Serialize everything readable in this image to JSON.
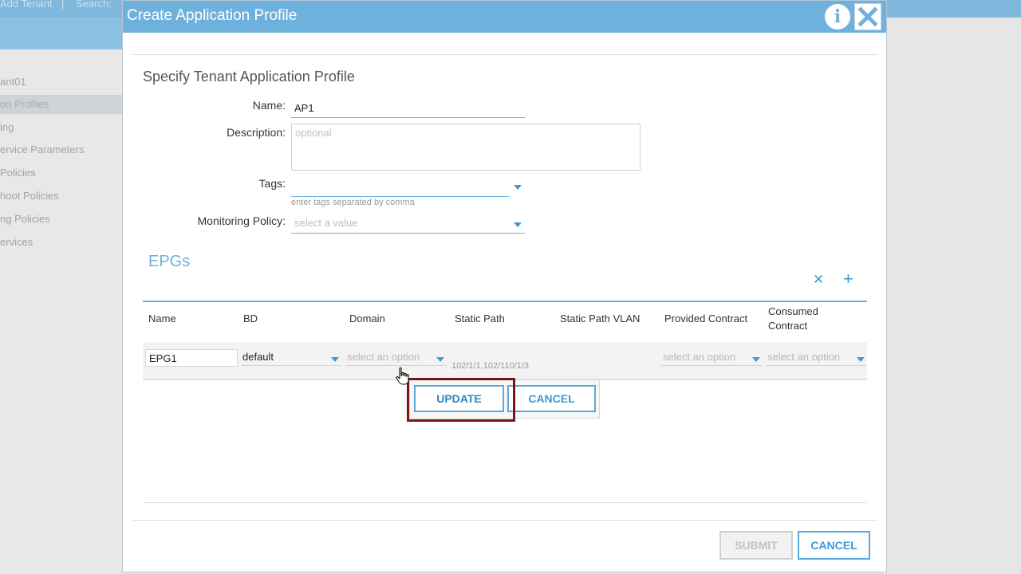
{
  "background": {
    "topbar": {
      "add_tenant": "Add Tenant",
      "separator": "|",
      "search": "Search:"
    },
    "sidebar_items": [
      {
        "label": "ant01"
      },
      {
        "label": "on Profiles",
        "selected": true
      },
      {
        "label": "ing"
      },
      {
        "label": "ervice Parameters"
      },
      {
        "label": "Policies"
      },
      {
        "label": "hoot Policies"
      },
      {
        "label": "ng Policies"
      },
      {
        "label": "ervices"
      }
    ]
  },
  "dialog": {
    "title": "Create Application Profile",
    "info_glyph": "i",
    "section_title": "Specify Tenant Application Profile",
    "fields": {
      "name_label": "Name:",
      "name_value": "AP1",
      "description_label": "Description:",
      "description_placeholder": "optional",
      "tags_label": "Tags:",
      "tags_hint": "enter tags separated by comma",
      "monitoring_label": "Monitoring Policy:",
      "monitoring_placeholder": "select a value"
    },
    "epgs": {
      "title": "EPGs",
      "delete_glyph": "✕",
      "add_glyph": "+",
      "columns": [
        "Name",
        "BD",
        "Domain",
        "Static Path",
        "Static Path VLAN",
        "Provided Contract",
        "Consumed Contract"
      ],
      "row": {
        "name": "EPG1",
        "bd": "default",
        "domain_placeholder": "select an option",
        "static_path": "102/1/1,102/110/1/3",
        "provided_placeholder": "select an option",
        "consumed_placeholder": "select an option"
      },
      "popup": {
        "update": "UPDATE",
        "cancel": "CANCEL"
      }
    },
    "footer": {
      "submit": "SUBMIT",
      "cancel": "CANCEL"
    }
  },
  "colors": {
    "accent": "#6fb1dd",
    "highlight": "#7a1515"
  }
}
